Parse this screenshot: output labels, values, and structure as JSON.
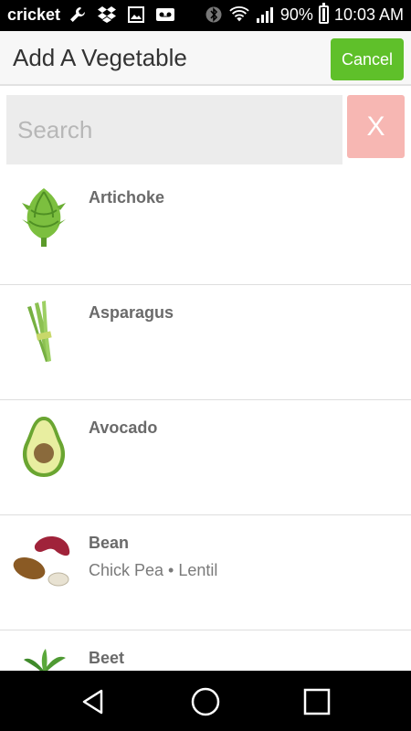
{
  "status_bar": {
    "carrier": "cricket",
    "battery": "90%",
    "time": "10:03 AM",
    "icons": [
      "wrench-icon",
      "dropbox-icon",
      "image-icon",
      "voicemail-icon",
      "bluetooth-icon",
      "wifi-icon",
      "signal-icon",
      "battery-icon"
    ]
  },
  "header": {
    "title": "Add A Vegetable",
    "cancel_label": "Cancel"
  },
  "search": {
    "placeholder": "Search",
    "value": "",
    "clear_label": "X"
  },
  "vegetables": [
    {
      "name": "Artichoke",
      "subtitle": "",
      "icon": "artichoke-icon"
    },
    {
      "name": "Asparagus",
      "subtitle": "",
      "icon": "asparagus-icon"
    },
    {
      "name": "Avocado",
      "subtitle": "",
      "icon": "avocado-icon"
    },
    {
      "name": "Bean",
      "subtitle": "Chick Pea • Lentil",
      "icon": "bean-icon"
    },
    {
      "name": "Beet",
      "subtitle": "",
      "icon": "beet-icon"
    }
  ],
  "nav_bar": {
    "icons": [
      "back-icon",
      "home-icon",
      "recents-icon"
    ]
  },
  "colors": {
    "accent_green": "#5fc02a",
    "clear_button": "#f7b7b3",
    "search_bg": "#ececec"
  }
}
